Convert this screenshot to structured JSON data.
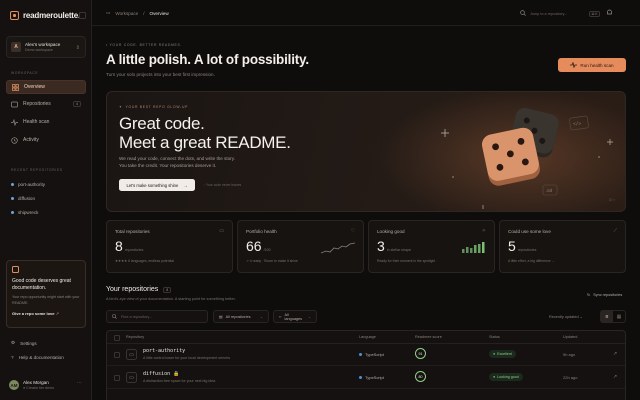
{
  "app": {
    "logo": "readmeroulette."
  },
  "workspace": {
    "initial": "A",
    "name": "Alex's workspace",
    "sub": "Demo workspace"
  },
  "sidebar": {
    "section_workspace": "WORKSPACE",
    "items": [
      {
        "label": "Overview",
        "icon": "grid-icon",
        "active": true
      },
      {
        "label": "Repositories",
        "icon": "repo-icon",
        "badge": "4"
      },
      {
        "label": "Health scan",
        "icon": "pulse-icon"
      },
      {
        "label": "Activity",
        "icon": "clock-icon"
      }
    ],
    "section_recent": "RECENT REPOSITORIES",
    "recent": [
      "port-authority",
      "diffusion",
      "shipwreck"
    ],
    "promo": {
      "title": "Good code deserves great documentation.",
      "text": "Your repo opportunity might start with your README.",
      "link": "Give a repo some love",
      "arrow": "↗"
    },
    "footer": [
      {
        "label": "Settings",
        "icon": "gear-icon"
      },
      {
        "label": "Help & documentation",
        "icon": "help-icon"
      }
    ],
    "user": {
      "initials": "AM",
      "name": "Alex Morgan",
      "plan": "● Creator tier demo"
    }
  },
  "topbar": {
    "breadcrumb_root": "Workspace",
    "breadcrumb_sep": "/",
    "breadcrumb_current": "Overview",
    "search_placeholder": "Jump to a repository...",
    "search_kbd": "⌘ K"
  },
  "header": {
    "eyebrow": "• YOUR CODE. BETTER READMES.",
    "title": "A little polish. A lot of possibility.",
    "subtitle": "Turn your solo projects into your best first impression.",
    "primary_button": "Run health scan"
  },
  "hero": {
    "eyebrow": "YOUR BEST REPO GLOW-UP",
    "headline_1": "Great code.",
    "headline_2": "Meet a great README.",
    "paragraph_1": "We read your code, connect the dots, and write the story.",
    "paragraph_2": "You take the credit. Your repositories deserve it.",
    "cta": "Let's make something shine",
    "note": "Your code never leaves"
  },
  "stats": [
    {
      "title": "Total repositories",
      "value": "8",
      "unit": "repositories",
      "foot": "★★★★ 6 languages, endless potential",
      "icon": "folder-icon"
    },
    {
      "title": "Portfolio health",
      "value": "66",
      "unit": "/100",
      "foot": "↗ 4 ready · Room to make it shine",
      "icon": "heart-icon"
    },
    {
      "title": "Looking good",
      "value": "3",
      "unit": "in stellar shape",
      "foot": "Ready for their moment in the spotlight",
      "icon": "sparkle-icon"
    },
    {
      "title": "Could use some love",
      "value": "5",
      "unit": "repositories",
      "foot": "A little effort, a big difference →",
      "icon": "wand-icon"
    }
  ],
  "repos": {
    "title": "Your repositories",
    "count": "8",
    "subtitle": "A bird's-eye view of your documentation. A starting point for something better.",
    "sync": "Sync repositories",
    "filter_placeholder": "Find a repository...",
    "select_1": "All repositories",
    "select_2": "All languages",
    "sort": "Recently updated",
    "columns": [
      "Repository",
      "Language",
      "Readmee score",
      "Status",
      "Updated"
    ],
    "rows": [
      {
        "name": "port-authority",
        "desc": "A little control tower for your local development servers",
        "language": "TypeScript",
        "lang_color": "#4e8fd6",
        "score": "91",
        "status": "Excellent",
        "updated": "9h ago"
      },
      {
        "name": "diffusion",
        "desc": "A distraction-free space for your next big idea.",
        "language": "TypeScript",
        "lang_color": "#4e8fd6",
        "score": "80",
        "status": "Looking good",
        "updated": "22h ago"
      }
    ]
  },
  "colors": {
    "accent": "#e68b5c",
    "bg": "#0f0d0c",
    "panel": "#161311",
    "success": "#8fcf86"
  }
}
